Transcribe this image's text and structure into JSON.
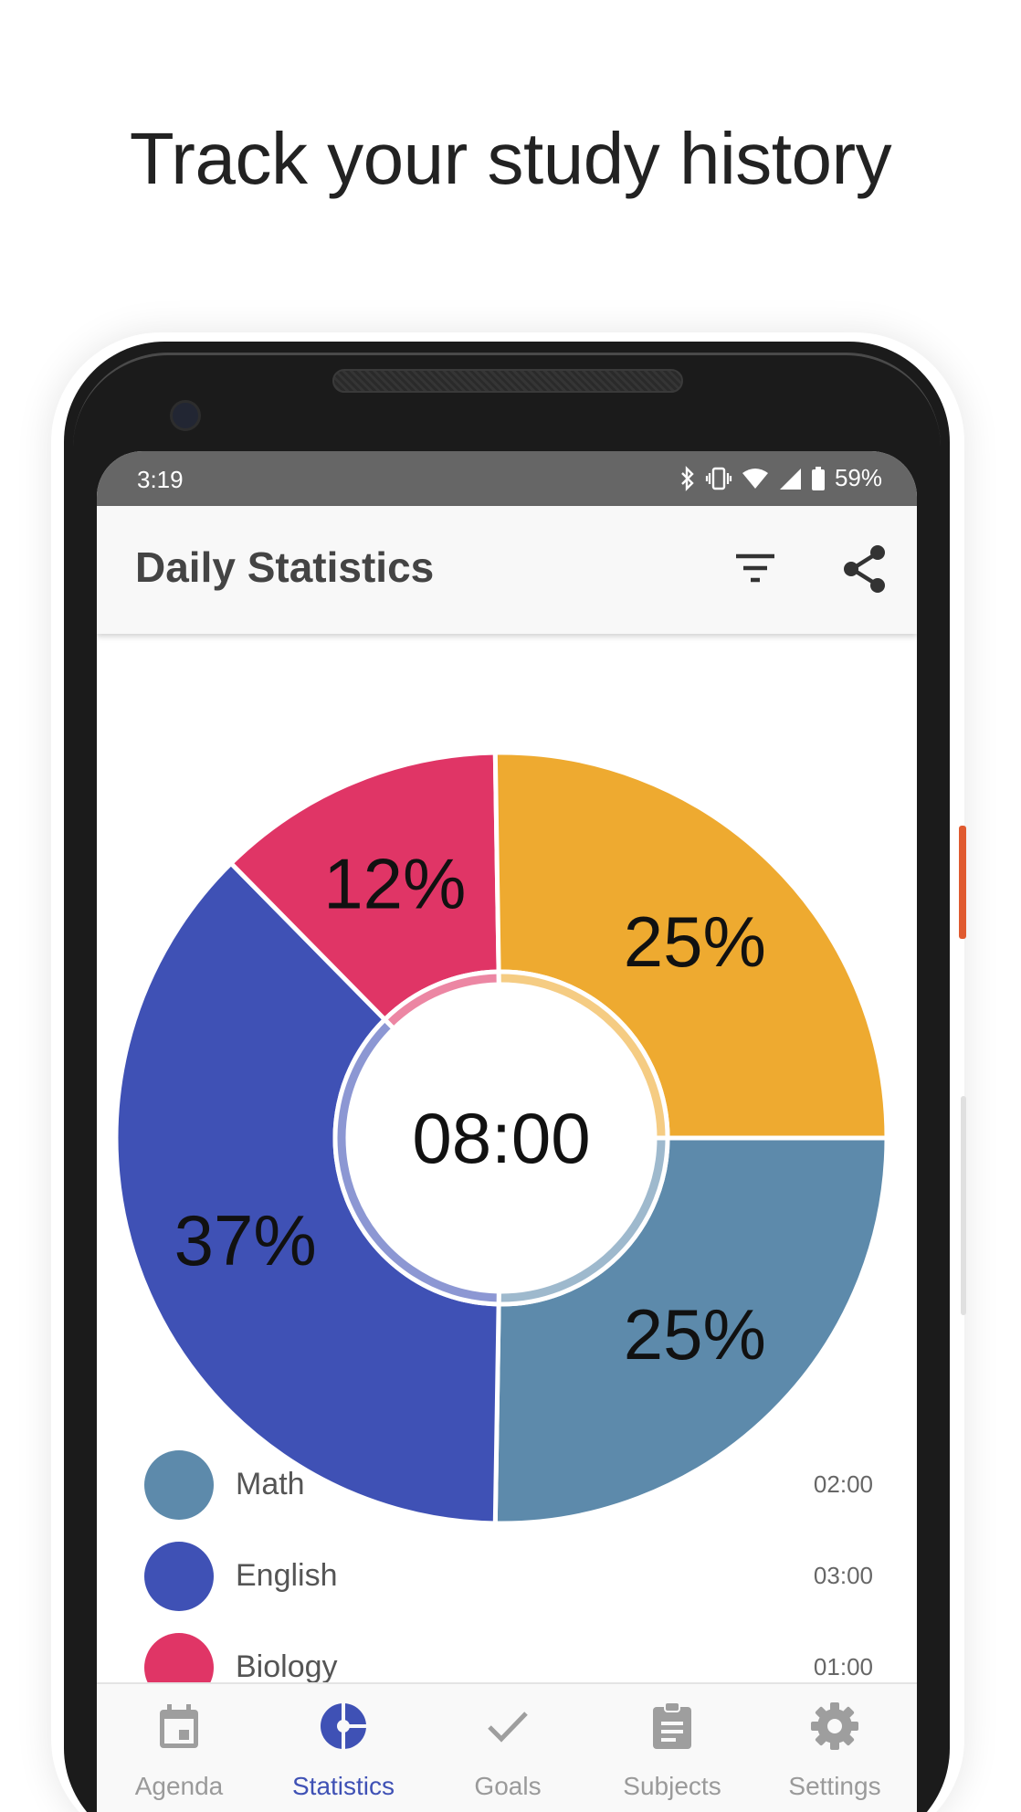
{
  "headline": "Track your study history",
  "status_bar": {
    "time": "3:19",
    "battery": "59%",
    "icons": [
      "bluetooth-icon",
      "vibrate-icon",
      "wifi-icon",
      "signal-icon",
      "battery-icon"
    ]
  },
  "app_bar": {
    "title": "Daily Statistics",
    "actions": [
      "filter-icon",
      "share-icon"
    ]
  },
  "chart_data": {
    "type": "pie",
    "variant": "donut",
    "center_label": "08:00",
    "slices": [
      {
        "name": "Math",
        "value": 25,
        "label": "25%",
        "color": "#5d8aab"
      },
      {
        "name": "English",
        "value": 37,
        "label": "37%",
        "color": "#3f51b5"
      },
      {
        "name": "Biology",
        "value": 12,
        "label": "12%",
        "color": "#e03566"
      },
      {
        "name": "",
        "value": 25,
        "label": "25%",
        "color": "#eeaa30"
      }
    ]
  },
  "legend": [
    {
      "name": "Math",
      "time": "02:00",
      "color": "#5d8aab"
    },
    {
      "name": "English",
      "time": "03:00",
      "color": "#3f51b5"
    },
    {
      "name": "Biology",
      "time": "01:00",
      "color": "#e03566"
    }
  ],
  "bottom_nav": {
    "active": "Statistics",
    "active_color": "#3f51b5",
    "items": [
      {
        "label": "Agenda",
        "icon": "calendar-icon"
      },
      {
        "label": "Statistics",
        "icon": "pie-chart-icon"
      },
      {
        "label": "Goals",
        "icon": "check-icon"
      },
      {
        "label": "Subjects",
        "icon": "clipboard-icon"
      },
      {
        "label": "Settings",
        "icon": "gear-icon"
      }
    ]
  }
}
